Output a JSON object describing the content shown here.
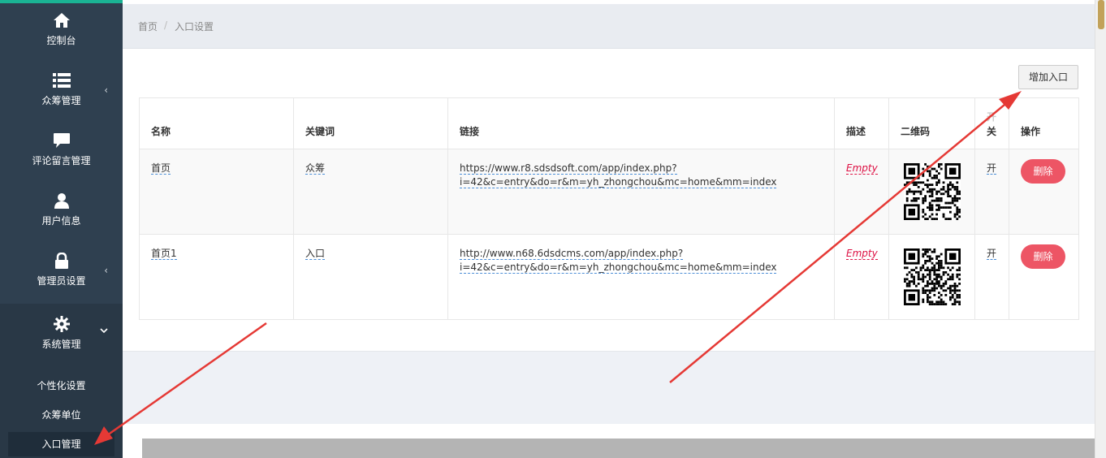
{
  "sidebar": {
    "items": [
      {
        "label": "控制台",
        "icon": "home-icon"
      },
      {
        "label": "众筹管理",
        "icon": "list-icon",
        "chevron": "‹"
      },
      {
        "label": "评论留言管理",
        "icon": "comment-icon"
      },
      {
        "label": "用户信息",
        "icon": "user-icon"
      },
      {
        "label": "管理员设置",
        "icon": "lock-icon",
        "chevron": "‹"
      },
      {
        "label": "系统管理",
        "icon": "gear-icon",
        "chevron": "⌄"
      }
    ],
    "submenu": [
      {
        "label": "个性化设置"
      },
      {
        "label": "众筹单位"
      },
      {
        "label": "入口管理"
      }
    ]
  },
  "breadcrumb": {
    "home": "首页",
    "sep": "/",
    "current": "入口设置"
  },
  "toolbar": {
    "add_label": "增加入口"
  },
  "table": {
    "headers": {
      "name": "名称",
      "keyword": "关键词",
      "link": "链接",
      "desc": "描述",
      "qrcode": "二维码",
      "switch_top": "开",
      "switch_bottom": "关",
      "action": "操作"
    },
    "rows": [
      {
        "name": "首页",
        "keyword": "众筹",
        "link_line1": "https://www.r8.sdsdsoft.com/app/index.php?",
        "link_line2": "i=42&c=entry&do=r&m=yh_zhongchou&mc=home&mm=index",
        "desc": "Empty",
        "switch": "开",
        "action": "删除"
      },
      {
        "name": "首页1",
        "keyword": "入口",
        "link_line1": "http://www.n68.6dsdcms.com/app/index.php?",
        "link_line2": "i=42&c=entry&do=r&m=yh_zhongchou&mc=home&mm=index",
        "desc": "Empty",
        "switch": "开",
        "action": "删除"
      }
    ]
  },
  "colors": {
    "sidebar": "#2f4050",
    "danger": "#ed5565",
    "empty_text": "#dd1144",
    "annotation_arrow": "#e53935"
  }
}
